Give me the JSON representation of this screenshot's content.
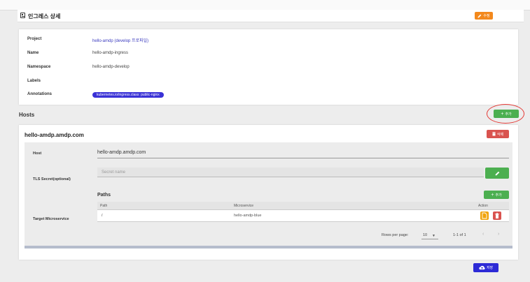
{
  "header": {
    "title": "인그레스 상세",
    "edit_label": "수정"
  },
  "details": [
    {
      "label": "Project",
      "value": "hello-amdp (develop 프로파일)",
      "link": true
    },
    {
      "label": "Name",
      "value": "hello-amdp-ingress"
    },
    {
      "label": "Namespace",
      "value": "hello-amdp-develop"
    },
    {
      "label": "Labels",
      "value": ""
    },
    {
      "label": "Annotations",
      "value": ""
    }
  ],
  "annotations_chip": "kubernetes.io/ingress.class: public-nginx",
  "hosts": {
    "title": "Hosts",
    "add_label": "추가",
    "host_name": "hello-amdp.amdp.com",
    "delete_label": "삭제",
    "host_label": "Host",
    "host_value": "hello-amdp.amdp.com",
    "tls_label": "TLS Secret(optional)",
    "tls_placeholder": "Secret name",
    "target_label": "Target Microservice",
    "paths_title": "Paths",
    "paths_add_label": "추가",
    "columns": {
      "path": "Path",
      "microservice": "Microservice",
      "action": "Action"
    },
    "rows": [
      {
        "path": "/",
        "microservice": "hello-amdp-blue"
      }
    ],
    "pager": {
      "rows_per_page_label": "Rows per page:",
      "rows_per_page": "10",
      "range": "1-1 of 1"
    }
  },
  "footer": {
    "save_label": "저장"
  },
  "colors": {
    "edit": "#f3891d",
    "add": "#4caf50",
    "delete": "#d9534f",
    "save": "#2d2ad6",
    "chip": "#3a32d6",
    "link": "#3b3bbf",
    "highlight": "#e53935"
  }
}
